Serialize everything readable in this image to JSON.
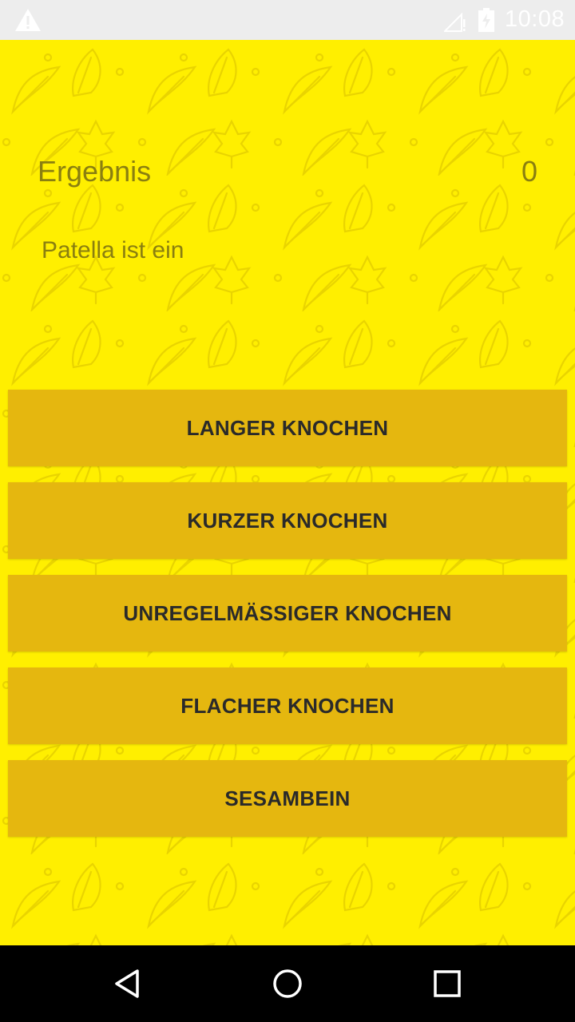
{
  "status_bar": {
    "time": "10:08",
    "icons": [
      "warning-icon",
      "signal-icon",
      "battery-charging-icon"
    ]
  },
  "quiz": {
    "result_label": "Ergebnis",
    "result_value": "0",
    "question": "Patella ist ein",
    "answers": [
      "LANGER KNOCHEN",
      "KURZER KNOCHEN",
      "UNREGELMÄSSIGER KNOCHEN",
      "FLACHER KNOCHEN",
      "SESAMBEIN"
    ]
  },
  "nav_bar": {
    "icons": [
      "back-icon",
      "home-icon",
      "recents-icon"
    ]
  },
  "colors": {
    "background": "#ffef00",
    "button": "#e5b70f",
    "text_muted": "#8a7f10",
    "status_bar": "#ededed",
    "nav_bar": "#000000"
  }
}
